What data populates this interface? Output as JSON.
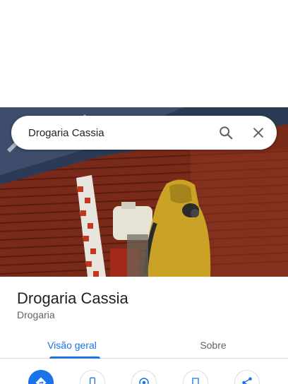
{
  "search": {
    "value": "Drogaria Cassia"
  },
  "hero": {
    "image_icon": "storefront-photo"
  },
  "place": {
    "name": "Drogaria Cassia",
    "category": "Drogaria"
  },
  "tabs": [
    {
      "label": "Visão geral",
      "active": true
    },
    {
      "label": "Sobre",
      "active": false
    }
  ],
  "actions": [
    {
      "icon": "directions-icon",
      "primary": true
    },
    {
      "icon": "phone-icon",
      "primary": false
    },
    {
      "icon": "nearby-icon",
      "primary": false
    },
    {
      "icon": "save-icon",
      "primary": false
    },
    {
      "icon": "share-icon",
      "primary": false
    }
  ],
  "colors": {
    "accent": "#1a73e8",
    "text_primary": "#202124",
    "text_secondary": "#5f6368"
  }
}
